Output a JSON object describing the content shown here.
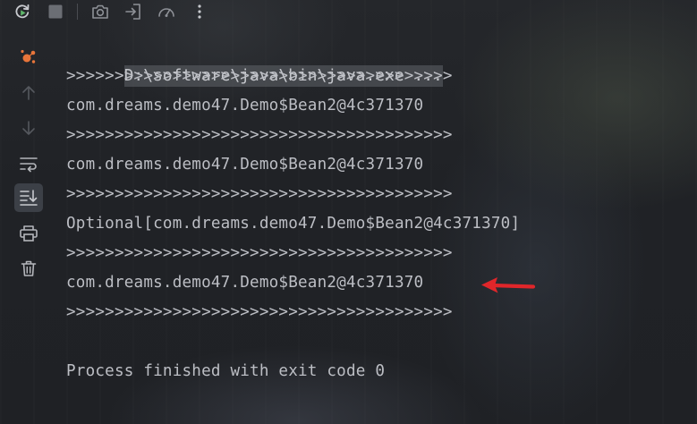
{
  "toolbar": {
    "icons": [
      "rerun-icon",
      "stop-icon",
      "camera-icon",
      "import-exit-icon",
      "gauge-icon",
      "more-options-icon"
    ]
  },
  "side_toolbar": {
    "icons": [
      "services-icon",
      "arrow-up-icon",
      "arrow-down-icon",
      "soft-wrap-icon",
      "scroll-to-end-icon",
      "print-icon",
      "trash-icon"
    ]
  },
  "console": {
    "command": "D:\\software\\java\\bin\\java.exe ...",
    "lines": [
      ">>>>>>>>>>>>>>>>>>>>>>>>>>>>>>>>>>>>>>>>",
      "com.dreams.demo47.Demo$Bean2@4c371370",
      ">>>>>>>>>>>>>>>>>>>>>>>>>>>>>>>>>>>>>>>>",
      "com.dreams.demo47.Demo$Bean2@4c371370",
      ">>>>>>>>>>>>>>>>>>>>>>>>>>>>>>>>>>>>>>>>",
      "Optional[com.dreams.demo47.Demo$Bean2@4c371370]",
      ">>>>>>>>>>>>>>>>>>>>>>>>>>>>>>>>>>>>>>>>",
      "com.dreams.demo47.Demo$Bean2@4c371370",
      ">>>>>>>>>>>>>>>>>>>>>>>>>>>>>>>>>>>>>>>>"
    ],
    "exit_message": "Process finished with exit code 0"
  },
  "colors": {
    "console_text": "#bcbec4",
    "accent_green": "#5fb86b",
    "accent_orange": "#e8753a",
    "annotation_red": "#e0262a"
  }
}
